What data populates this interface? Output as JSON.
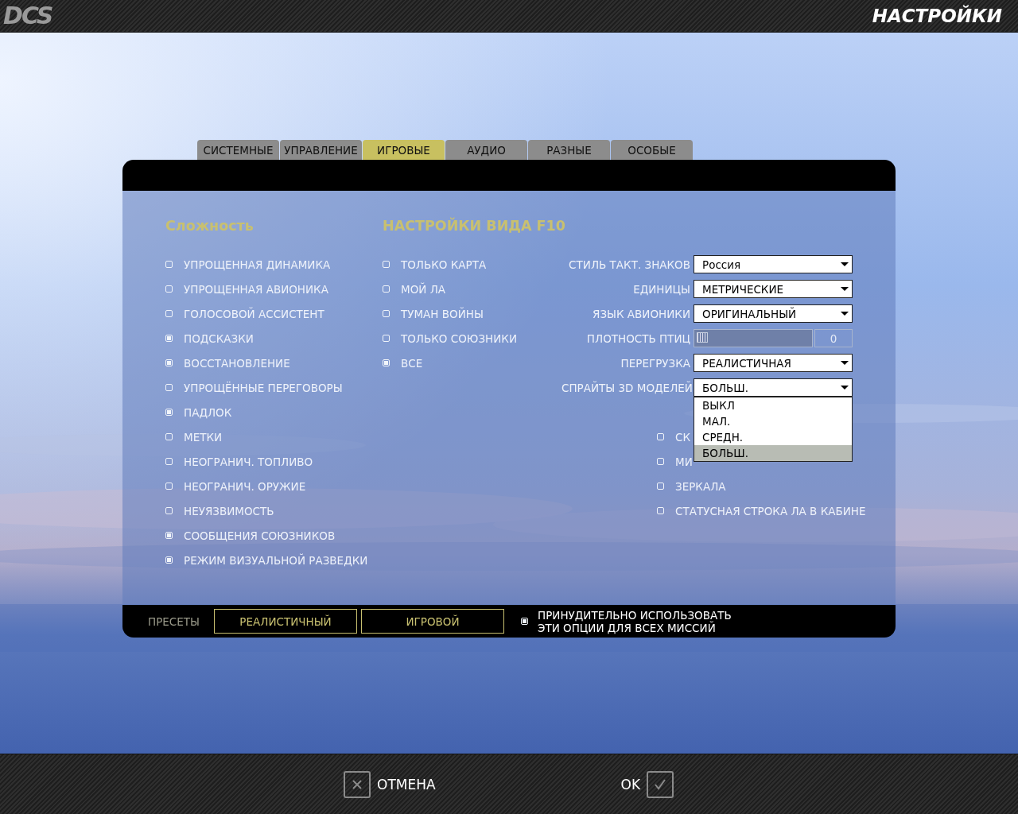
{
  "app": {
    "logo": "DCS",
    "title": "НАСТРОЙКИ"
  },
  "tabs": [
    {
      "label": "СИСТЕМНЫЕ",
      "selected": false
    },
    {
      "label": "УПРАВЛЕНИЕ",
      "selected": false
    },
    {
      "label": "ИГРОВЫЕ",
      "selected": true
    },
    {
      "label": "АУДИО",
      "selected": false
    },
    {
      "label": "РАЗНЫЕ",
      "selected": false
    },
    {
      "label": "ОСОБЫЕ",
      "selected": false
    }
  ],
  "difficulty": {
    "heading": "Сложность",
    "options": [
      {
        "label": "УПРОЩЕННАЯ ДИНАМИКА",
        "checked": false
      },
      {
        "label": "УПРОЩЕННАЯ АВИОНИКА",
        "checked": false
      },
      {
        "label": "ГОЛОСОВОЙ АССИСТЕНТ",
        "checked": false
      },
      {
        "label": "ПОДСКАЗКИ",
        "checked": true
      },
      {
        "label": "ВОССТАНОВЛЕНИЕ",
        "checked": true
      },
      {
        "label": "УПРОЩЁННЫЕ ПЕРЕГОВОРЫ",
        "checked": false
      },
      {
        "label": "ПАДЛОК",
        "checked": true
      },
      {
        "label": "МЕТКИ",
        "checked": false
      },
      {
        "label": "НЕОГРАНИЧ. ТОПЛИВО",
        "checked": false
      },
      {
        "label": "НЕОГРАНИЧ. ОРУЖИЕ",
        "checked": false
      },
      {
        "label": "НЕУЯЗВИМОСТЬ",
        "checked": false
      },
      {
        "label": "СООБЩЕНИЯ СОЮЗНИКОВ",
        "checked": true
      },
      {
        "label": "РЕЖИМ ВИЗУАЛЬНОЙ РАЗВЕДКИ",
        "checked": true
      }
    ]
  },
  "f10_view": {
    "heading": "НАСТРОЙКИ ВИДА F10",
    "options": [
      {
        "label": "ТОЛЬКО КАРТА",
        "checked": false
      },
      {
        "label": "МОЙ ЛА",
        "checked": false
      },
      {
        "label": "ТУМАН ВОЙНЫ",
        "checked": false
      },
      {
        "label": "ТОЛЬКО СОЮЗНИКИ",
        "checked": false
      },
      {
        "label": "ВСЕ",
        "checked": true
      }
    ]
  },
  "settings": [
    {
      "kind": "select",
      "label": "СТИЛЬ ТАКТ. ЗНАКОВ",
      "value": "Россия"
    },
    {
      "kind": "select",
      "label": "ЕДИНИЦЫ",
      "value": "МЕТРИЧЕСКИЕ"
    },
    {
      "kind": "select",
      "label": "ЯЗЫК АВИОНИКИ",
      "value": "ОРИГИНАЛЬНЫЙ"
    },
    {
      "kind": "slider",
      "label": "ПЛОТНОСТЬ ПТИЦ",
      "level": 0,
      "reading": "0"
    },
    {
      "kind": "select",
      "label": "ПЕРЕГРУЗКА",
      "value": "РЕАЛИСТИЧНАЯ"
    },
    {
      "kind": "select",
      "label": "СПРАЙТЫ 3D МОДЕЛЕЙ",
      "value": "БОЛЬШ.",
      "expanded": true,
      "options": [
        {
          "label": "ВЫКЛ",
          "selected": false
        },
        {
          "label": "МАЛ.",
          "selected": false
        },
        {
          "label": "СРЕДН.",
          "selected": false
        },
        {
          "label": "БОЛЬШ.",
          "selected": true
        }
      ]
    }
  ],
  "cockpit_options": [
    {
      "label": "СК",
      "checked": false
    },
    {
      "label": "МИ",
      "checked": false
    },
    {
      "label": "ЗЕРКАЛА",
      "checked": false
    },
    {
      "label": "СТАТУСНАЯ СТРОКА ЛА В КАБИНЕ",
      "checked": false
    }
  ],
  "presets": {
    "label": "ПРЕСЕТЫ",
    "buttons": [
      "РЕАЛИСТИЧНЫЙ",
      "ИГРОВОЙ"
    ],
    "force": {
      "label": "ПРИНУДИТЕЛЬНО ИСПОЛЬЗОВАТЬ ЭТИ ОПЦИИ ДЛЯ ВСЕХ МИССИЙ",
      "checked": true
    }
  },
  "footer": {
    "cancel": "ОТМЕНА",
    "ok": "OK"
  }
}
